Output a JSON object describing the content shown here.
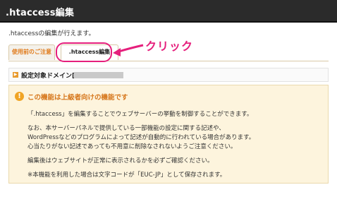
{
  "header": {
    "title": ".htaccess編集"
  },
  "intro": ".htaccessの編集が行えます。",
  "tabs": [
    {
      "label": "使用前のご注意"
    },
    {
      "label": ".htaccess編集"
    }
  ],
  "annotation": {
    "label": "クリック",
    "color": "#e51f7c"
  },
  "domain": {
    "label": "設定対象ドメイン["
  },
  "warning": {
    "title": "この機能は上級者向けの機能です",
    "lines": [
      "「.htaccess」を編集することでウェブサーバーの挙動を制御することができます。",
      "なお、本サーバーパネルで提供している一部機能の設定に関する記述や、",
      "WordPressなどのプログラムによって記述が自動的に行われている場合があります。",
      "心当たりがない記述であっても不用意に削除なされないようご注意ください。",
      "編集後はウェブサイトが正常に表示されるかを必ずご確認ください。",
      "※本機能を利用した場合は文字コードが「EUC-JP」として保存されます。"
    ]
  },
  "colors": {
    "accent": "#e07a1b",
    "warning_bg": "#fdf4dd",
    "title_bar": "#2b2b2b"
  }
}
